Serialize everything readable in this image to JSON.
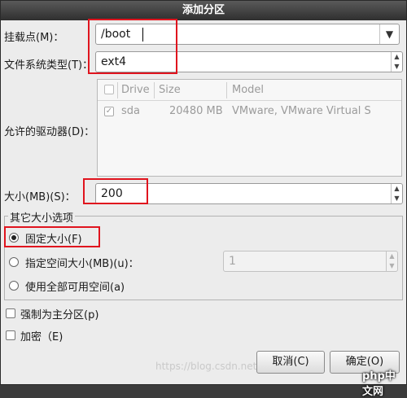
{
  "window": {
    "title": "添加分区"
  },
  "mount": {
    "label": "挂载点(M)：",
    "value": "/boot"
  },
  "fstype": {
    "label": "文件系统类型(T)：",
    "value": "ext4"
  },
  "drives": {
    "label": "允许的驱动器(D)：",
    "columns": [
      "Drive",
      "Size",
      "Model"
    ],
    "rows": [
      {
        "drive": "sda",
        "size": "20480 MB",
        "model": "VMware, VMware Virtual S"
      }
    ]
  },
  "size": {
    "label": "大小(MB)(S)：",
    "value": "200"
  },
  "size_options": {
    "legend": "其它大小选项",
    "fixed": "固定大小(F)",
    "up_to": "指定空间大小(MB)(u)：",
    "up_to_value": "1",
    "fill": "使用全部可用空间(a)"
  },
  "force_primary": "强制为主分区(p)",
  "encrypt": "加密（E)",
  "buttons": {
    "cancel": "取消(C)",
    "ok": "确定(O)"
  },
  "watermark": "https://blog.csdn.net/...",
  "logo": "php中文网"
}
